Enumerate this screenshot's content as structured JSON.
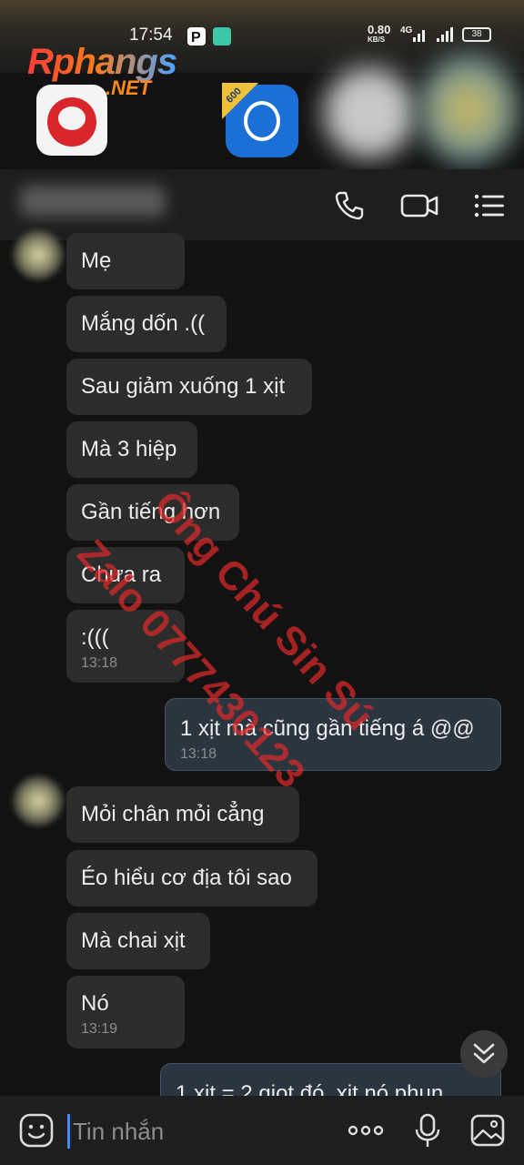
{
  "status_bar": {
    "time": "17:54",
    "net_speed_value": "0.80",
    "net_speed_unit": "KB/S",
    "network_type": "4G",
    "battery": "38"
  },
  "watermark_logo": {
    "text": "Rphangs",
    "sub": ".NET"
  },
  "watermark_text": {
    "line1": "Ông Chú Sin Sú",
    "line2": "Zalo 0777430123"
  },
  "header": {
    "call_icon": "phone-icon",
    "video_icon": "video-icon",
    "menu_icon": "menu-list-icon"
  },
  "messages": [
    {
      "text": "Mẹ",
      "time": ""
    },
    {
      "text": "Mắng dốn .((",
      "time": ""
    },
    {
      "text": "Sau giảm xuống 1 xịt",
      "time": ""
    },
    {
      "text": "Mà 3 hiệp",
      "time": ""
    },
    {
      "text": "Gần tiếng hơn",
      "time": ""
    },
    {
      "text": "Chưa ra",
      "time": ""
    },
    {
      "text": ":(((",
      "time": "13:18"
    },
    {
      "text": "1 xịt mà cũng gần tiếng á @@",
      "time": "13:18"
    },
    {
      "text": "Mỏi chân mỏi cẳng",
      "time": ""
    },
    {
      "text": "Éo hiểu cơ địa tôi sao",
      "time": ""
    },
    {
      "text": "Mà chai xịt",
      "time": ""
    },
    {
      "text": "Nó",
      "time": "13:19"
    },
    {
      "text": "1 xịt = 2 giọt đó, xịt nó phun",
      "time": ""
    }
  ],
  "input": {
    "placeholder": "Tin nhắn"
  },
  "colors": {
    "background": "#121212",
    "bubble_in": "#2c2c2c",
    "bubble_out": "#2b3540",
    "cursor": "#3d8bff",
    "watermark": "#dc2828"
  }
}
